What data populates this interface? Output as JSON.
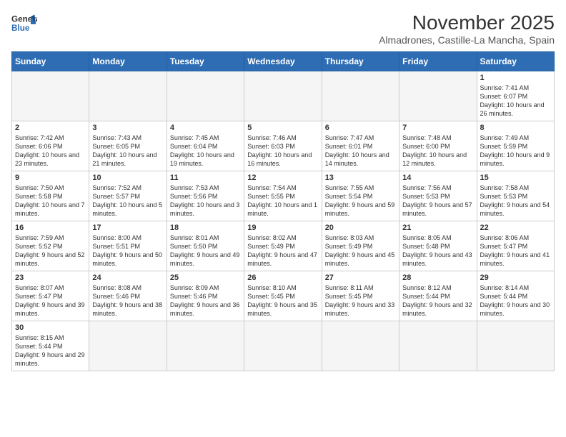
{
  "header": {
    "logo_general": "General",
    "logo_blue": "Blue",
    "month_year": "November 2025",
    "location": "Almadrones, Castille-La Mancha, Spain"
  },
  "days_of_week": [
    "Sunday",
    "Monday",
    "Tuesday",
    "Wednesday",
    "Thursday",
    "Friday",
    "Saturday"
  ],
  "weeks": [
    [
      {
        "day": "",
        "info": ""
      },
      {
        "day": "",
        "info": ""
      },
      {
        "day": "",
        "info": ""
      },
      {
        "day": "",
        "info": ""
      },
      {
        "day": "",
        "info": ""
      },
      {
        "day": "",
        "info": ""
      },
      {
        "day": "1",
        "info": "Sunrise: 7:41 AM\nSunset: 6:07 PM\nDaylight: 10 hours and 26 minutes."
      }
    ],
    [
      {
        "day": "2",
        "info": "Sunrise: 7:42 AM\nSunset: 6:06 PM\nDaylight: 10 hours and 23 minutes."
      },
      {
        "day": "3",
        "info": "Sunrise: 7:43 AM\nSunset: 6:05 PM\nDaylight: 10 hours and 21 minutes."
      },
      {
        "day": "4",
        "info": "Sunrise: 7:45 AM\nSunset: 6:04 PM\nDaylight: 10 hours and 19 minutes."
      },
      {
        "day": "5",
        "info": "Sunrise: 7:46 AM\nSunset: 6:03 PM\nDaylight: 10 hours and 16 minutes."
      },
      {
        "day": "6",
        "info": "Sunrise: 7:47 AM\nSunset: 6:01 PM\nDaylight: 10 hours and 14 minutes."
      },
      {
        "day": "7",
        "info": "Sunrise: 7:48 AM\nSunset: 6:00 PM\nDaylight: 10 hours and 12 minutes."
      },
      {
        "day": "8",
        "info": "Sunrise: 7:49 AM\nSunset: 5:59 PM\nDaylight: 10 hours and 9 minutes."
      }
    ],
    [
      {
        "day": "9",
        "info": "Sunrise: 7:50 AM\nSunset: 5:58 PM\nDaylight: 10 hours and 7 minutes."
      },
      {
        "day": "10",
        "info": "Sunrise: 7:52 AM\nSunset: 5:57 PM\nDaylight: 10 hours and 5 minutes."
      },
      {
        "day": "11",
        "info": "Sunrise: 7:53 AM\nSunset: 5:56 PM\nDaylight: 10 hours and 3 minutes."
      },
      {
        "day": "12",
        "info": "Sunrise: 7:54 AM\nSunset: 5:55 PM\nDaylight: 10 hours and 1 minute."
      },
      {
        "day": "13",
        "info": "Sunrise: 7:55 AM\nSunset: 5:54 PM\nDaylight: 9 hours and 59 minutes."
      },
      {
        "day": "14",
        "info": "Sunrise: 7:56 AM\nSunset: 5:53 PM\nDaylight: 9 hours and 57 minutes."
      },
      {
        "day": "15",
        "info": "Sunrise: 7:58 AM\nSunset: 5:53 PM\nDaylight: 9 hours and 54 minutes."
      }
    ],
    [
      {
        "day": "16",
        "info": "Sunrise: 7:59 AM\nSunset: 5:52 PM\nDaylight: 9 hours and 52 minutes."
      },
      {
        "day": "17",
        "info": "Sunrise: 8:00 AM\nSunset: 5:51 PM\nDaylight: 9 hours and 50 minutes."
      },
      {
        "day": "18",
        "info": "Sunrise: 8:01 AM\nSunset: 5:50 PM\nDaylight: 9 hours and 49 minutes."
      },
      {
        "day": "19",
        "info": "Sunrise: 8:02 AM\nSunset: 5:49 PM\nDaylight: 9 hours and 47 minutes."
      },
      {
        "day": "20",
        "info": "Sunrise: 8:03 AM\nSunset: 5:49 PM\nDaylight: 9 hours and 45 minutes."
      },
      {
        "day": "21",
        "info": "Sunrise: 8:05 AM\nSunset: 5:48 PM\nDaylight: 9 hours and 43 minutes."
      },
      {
        "day": "22",
        "info": "Sunrise: 8:06 AM\nSunset: 5:47 PM\nDaylight: 9 hours and 41 minutes."
      }
    ],
    [
      {
        "day": "23",
        "info": "Sunrise: 8:07 AM\nSunset: 5:47 PM\nDaylight: 9 hours and 39 minutes."
      },
      {
        "day": "24",
        "info": "Sunrise: 8:08 AM\nSunset: 5:46 PM\nDaylight: 9 hours and 38 minutes."
      },
      {
        "day": "25",
        "info": "Sunrise: 8:09 AM\nSunset: 5:46 PM\nDaylight: 9 hours and 36 minutes."
      },
      {
        "day": "26",
        "info": "Sunrise: 8:10 AM\nSunset: 5:45 PM\nDaylight: 9 hours and 35 minutes."
      },
      {
        "day": "27",
        "info": "Sunrise: 8:11 AM\nSunset: 5:45 PM\nDaylight: 9 hours and 33 minutes."
      },
      {
        "day": "28",
        "info": "Sunrise: 8:12 AM\nSunset: 5:44 PM\nDaylight: 9 hours and 32 minutes."
      },
      {
        "day": "29",
        "info": "Sunrise: 8:14 AM\nSunset: 5:44 PM\nDaylight: 9 hours and 30 minutes."
      }
    ],
    [
      {
        "day": "30",
        "info": "Sunrise: 8:15 AM\nSunset: 5:44 PM\nDaylight: 9 hours and 29 minutes."
      },
      {
        "day": "",
        "info": ""
      },
      {
        "day": "",
        "info": ""
      },
      {
        "day": "",
        "info": ""
      },
      {
        "day": "",
        "info": ""
      },
      {
        "day": "",
        "info": ""
      },
      {
        "day": "",
        "info": ""
      }
    ]
  ]
}
